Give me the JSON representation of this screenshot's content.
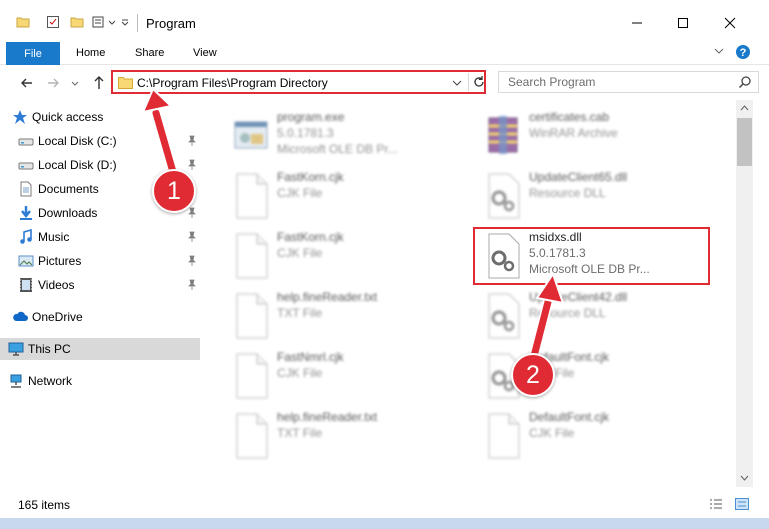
{
  "window": {
    "title": "Program",
    "minimize_icon": "minimize-icon",
    "maximize_icon": "maximize-icon",
    "close_icon": "close-icon"
  },
  "ribbon": {
    "tabs": [
      {
        "label": "File",
        "active": true
      },
      {
        "label": "Home"
      },
      {
        "label": "Share"
      },
      {
        "label": "View"
      }
    ]
  },
  "address_bar": {
    "path": "C:\\Program Files\\Program Directory"
  },
  "search": {
    "placeholder": "Search Program"
  },
  "nav_pane": {
    "items": [
      {
        "label": "Quick access",
        "icon": "star-icon"
      },
      {
        "label": "Local Disk (C:)",
        "icon": "drive-icon",
        "pinned": true
      },
      {
        "label": "Local Disk (D:)",
        "icon": "drive-icon",
        "pinned": true
      },
      {
        "label": "Documents",
        "icon": "documents-icon",
        "pinned": true
      },
      {
        "label": "Downloads",
        "icon": "downloads-icon",
        "pinned": true
      },
      {
        "label": "Music",
        "icon": "music-icon",
        "pinned": true
      },
      {
        "label": "Pictures",
        "icon": "pictures-icon",
        "pinned": true
      },
      {
        "label": "Videos",
        "icon": "videos-icon",
        "pinned": true
      },
      {
        "label": "OneDrive",
        "icon": "cloud-icon"
      },
      {
        "label": "This PC",
        "icon": "computer-icon",
        "selected": true
      },
      {
        "label": "Network",
        "icon": "network-icon"
      }
    ]
  },
  "files": [
    {
      "name": "program.exe",
      "line1": "5.0.1781.3",
      "line2": "Microsoft OLE DB Pr...",
      "icon": "exe-icon"
    },
    {
      "name": "certificates.cab",
      "line1": "WinRAR Archive",
      "line2": "",
      "icon": "archive-icon"
    },
    {
      "name": "FastKorn.cjk",
      "line1": "CJK File",
      "line2": "",
      "icon": "file-icon"
    },
    {
      "name": "UpdateClient65.dll",
      "line1": "Resource DLL",
      "line2": "",
      "icon": "dll-icon"
    },
    {
      "name": "FastKorn.cjk",
      "line1": "CJK File",
      "line2": "",
      "icon": "file-icon"
    },
    {
      "name": "msidxs.dll",
      "line1": "5.0.1781.3",
      "line2": "Microsoft OLE DB Pr...",
      "icon": "dll-icon"
    },
    {
      "name": "help.fineReader.txt",
      "line1": "TXT File",
      "line2": "",
      "icon": "file-icon"
    },
    {
      "name": "UpdateClient42.dll",
      "line1": "Resource DLL",
      "line2": "",
      "icon": "dll-icon"
    },
    {
      "name": "FastNmrl.cjk",
      "line1": "CJK File",
      "line2": "",
      "icon": "file-icon"
    },
    {
      "name": "DefaultFont.cjk",
      "line1": "CJK File",
      "line2": "",
      "icon": "dll-icon"
    },
    {
      "name": "help.fineReader.txt",
      "line1": "TXT File",
      "line2": "",
      "icon": "file-icon"
    },
    {
      "name": "DefaultFont.cjk",
      "line1": "CJK File",
      "line2": "",
      "icon": "file-icon"
    }
  ],
  "status_bar": {
    "item_count": "165 items"
  },
  "annotations": {
    "step1": "1",
    "step2": "2",
    "color": "#e02a34"
  },
  "colors": {
    "accent": "#1979ca",
    "highlight": "#e02a34",
    "selected_bg": "#d9d9d9"
  }
}
